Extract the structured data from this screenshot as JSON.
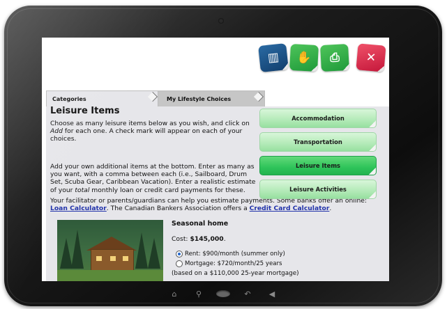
{
  "tabs": [
    {
      "label": "Categories"
    },
    {
      "label": "My Lifestyle Choices"
    }
  ],
  "heading": "Leisure Items",
  "intro": {
    "p1_a": "Choose as many leisure items below as you wish, and click on ",
    "p1_add": "Add",
    "p1_b": " for each one. A check mark will appear on each of your choices.",
    "p2": "Add your own additional items at the bottom. Enter as many as you want, with a comma between each (i.e., Sailboard, Drum Set, Scuba Gear, Caribbean Vacation). Enter a realistic estimate of your ",
    "p2_total": "total",
    "p2_b": " monthly loan or credit card payments for these.",
    "p3_a": "Your facilitator or parents/guardians can help you estimate payments. Some banks offer an online: ",
    "loan_link": "Loan Calculator",
    "p3_b": ". The Canadian Bankers Association offers a ",
    "credit_link": "Credit Card Calculator",
    "p3_c": "."
  },
  "side_buttons": [
    {
      "label": "Accommodation",
      "active": false
    },
    {
      "label": "Transportation",
      "active": false
    },
    {
      "label": "Leisure Items",
      "active": true
    },
    {
      "label": "Leisure Activities",
      "active": false
    }
  ],
  "item": {
    "title": "Seasonal home",
    "cost_label": "Cost: ",
    "cost_value": "$145,000",
    "cost_end": ".",
    "options": [
      {
        "label": "Rent: $900/month (summer only)",
        "selected": true
      },
      {
        "label": "Mortgage: $720/month/25 years",
        "selected": false
      }
    ],
    "note": "(based on a $110,000 25-year mortgage)"
  },
  "icons": [
    "books-icon",
    "hand-money-icon",
    "printer-icon",
    "exit-icon"
  ],
  "colors": {
    "active_green": "#2ec45a",
    "light_green": "#b9ecbd",
    "link": "#2233aa",
    "exit_red": "#d9263f"
  }
}
